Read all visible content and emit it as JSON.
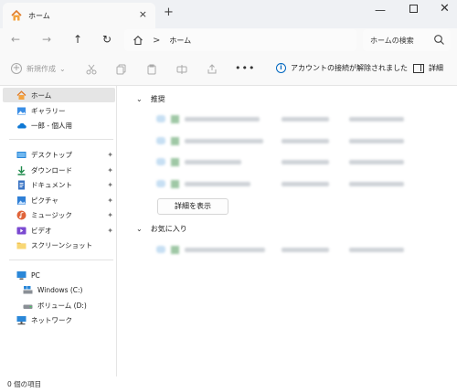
{
  "window": {
    "tab_title": "ホーム",
    "tab_close_glyph": "×",
    "new_tab_glyph": "+",
    "minimize_glyph": "—",
    "close_glyph": "✕"
  },
  "navbar": {
    "back_glyph": "←",
    "forward_glyph": "→",
    "up_glyph": "↑",
    "refresh_glyph": "↻",
    "separator_glyph": ">",
    "address": "ホーム",
    "search_placeholder": "ホームの検索"
  },
  "toolbar": {
    "new_label": "新規作成",
    "new_chevron": "⌄",
    "more_glyph": "•••",
    "info_text": "アカウントの接続が解除されました",
    "details_label": "詳細",
    "accent_color": "#0067c0"
  },
  "sidebar": {
    "items": [
      {
        "label": "ホーム",
        "icon": "home-icon"
      },
      {
        "label": "ギャラリー",
        "icon": "gallery-icon"
      },
      {
        "label": "一郎 - 個人用",
        "icon": "onedrive-icon"
      },
      {
        "label": "デスクトップ",
        "icon": "desktop-icon"
      },
      {
        "label": "ダウンロード",
        "icon": "download-icon"
      },
      {
        "label": "ドキュメント",
        "icon": "documents-icon"
      },
      {
        "label": "ピクチャ",
        "icon": "pictures-icon"
      },
      {
        "label": "ミュージック",
        "icon": "music-icon"
      },
      {
        "label": "ビデオ",
        "icon": "videos-icon"
      },
      {
        "label": "スクリーンショット",
        "icon": "folder-icon"
      },
      {
        "label": "PC",
        "icon": "pc-icon"
      },
      {
        "label": "Windows (C:)",
        "icon": "drive-c-icon"
      },
      {
        "label": "ボリューム (D:)",
        "icon": "drive-d-icon"
      },
      {
        "label": "ネットワーク",
        "icon": "network-icon"
      }
    ],
    "pin_glyph": "📌"
  },
  "main": {
    "recommended_label": "推奨",
    "favorites_label": "お気に入り",
    "group_chevron": "⌄",
    "show_more_label": "詳細を表示"
  },
  "status": {
    "item_count": "0 個の項目"
  }
}
